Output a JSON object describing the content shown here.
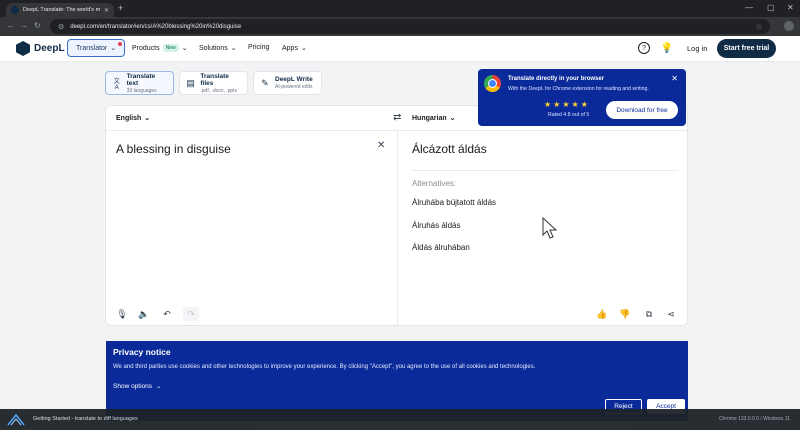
{
  "browser": {
    "tab_title": "DeepL Translate: The world's m",
    "url": "deepl.com/en/translator#en/cs/A%20blessing%20in%20disguise"
  },
  "header": {
    "logo_text": "DeepL",
    "translator_label": "Translator",
    "nav": {
      "products": "Products",
      "new_badge": "New",
      "solutions": "Solutions",
      "pricing": "Pricing",
      "apps": "Apps"
    },
    "help_icon": "?",
    "login": "Log in",
    "trial": "Start free trial"
  },
  "modes": [
    {
      "title": "Translate text",
      "sub": "33 languages",
      "icon": "文A"
    },
    {
      "title": "Translate files",
      "sub": ".pdf, .docx, .pptx",
      "icon": "▤"
    },
    {
      "title": "DeepL Write",
      "sub": "AI-powered edits",
      "icon": "✎"
    }
  ],
  "translator": {
    "source_lang": "English",
    "target_lang": "Hungarian",
    "source_text": "A blessing in disguise",
    "target_text": "Álcázott áldás",
    "alternatives_label": "Alternatives:",
    "alternatives": [
      "Álruhába bújtatott áldás",
      "Álruhás áldás",
      "Áldás álruhában"
    ]
  },
  "promo": {
    "title": "Translate directly in your browser",
    "desc": "With the DeepL for Chrome extension for reading and writing.",
    "stars": "★★★★★",
    "rating_value": 4.8,
    "rating": "Rated 4.8 out of 5",
    "button": "Download for free"
  },
  "privacy": {
    "title": "Privacy notice",
    "text": "We and third parties use cookies and other technologies to improve your experience. By clicking \"Accept\", you agree to the use of all cookies and technologies.",
    "options": "Show options",
    "reject": "Reject",
    "accept": "Accept"
  },
  "recording": {
    "title": "Getting Started - translate to diff languages",
    "right": "Chrome 133.0.0.0 / Windows 11"
  },
  "colors": {
    "brand_navy": "#0f2b46",
    "promo_blue": "#0b2a9a",
    "accent_blue": "#3c6dc9"
  }
}
